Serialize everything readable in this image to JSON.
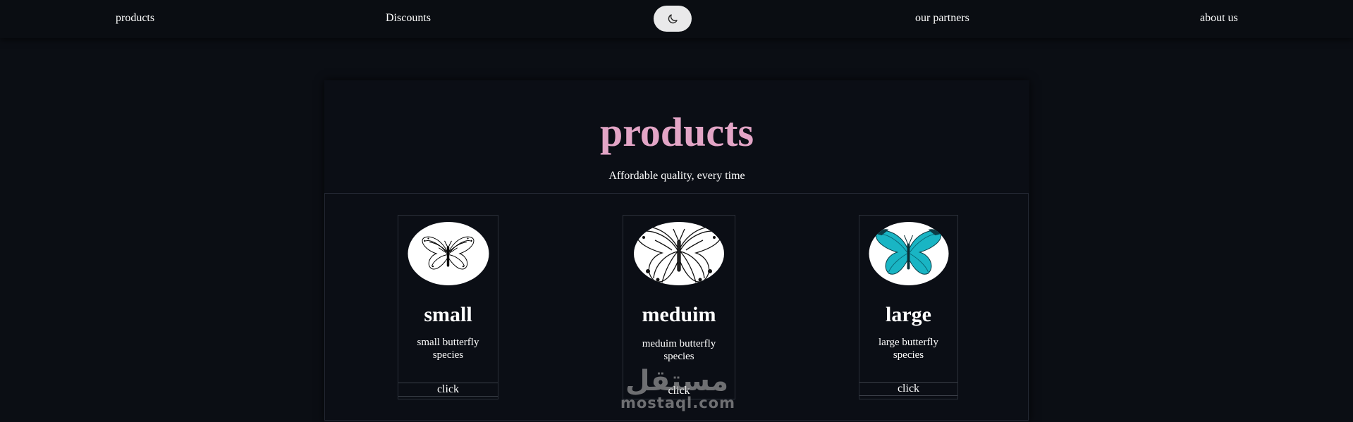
{
  "nav": {
    "products": "products",
    "discounts": "Discounts",
    "partners": "our partners",
    "about": "about us",
    "theme_icon": "moon-icon"
  },
  "hero": {
    "title": "products",
    "subtitle": "Affordable quality, every time"
  },
  "cards": [
    {
      "name": "small",
      "description": "small butterfly species",
      "button": "click",
      "image": "black-white-butterfly"
    },
    {
      "name": "meduim",
      "description": "meduim butterfly species",
      "button": "click",
      "image": "engraved-butterfly"
    },
    {
      "name": "large",
      "description": "large butterfly species",
      "button": "click",
      "image": "turquoise-butterfly"
    }
  ],
  "watermark": {
    "text": "mostaql.com",
    "arabic_text": "مستقل"
  },
  "colors": {
    "background": "#0b0e14",
    "accent_title": "#e3a5c6",
    "toggle": "#e9e9ea",
    "butterfly_teal": "#19b5c4"
  }
}
